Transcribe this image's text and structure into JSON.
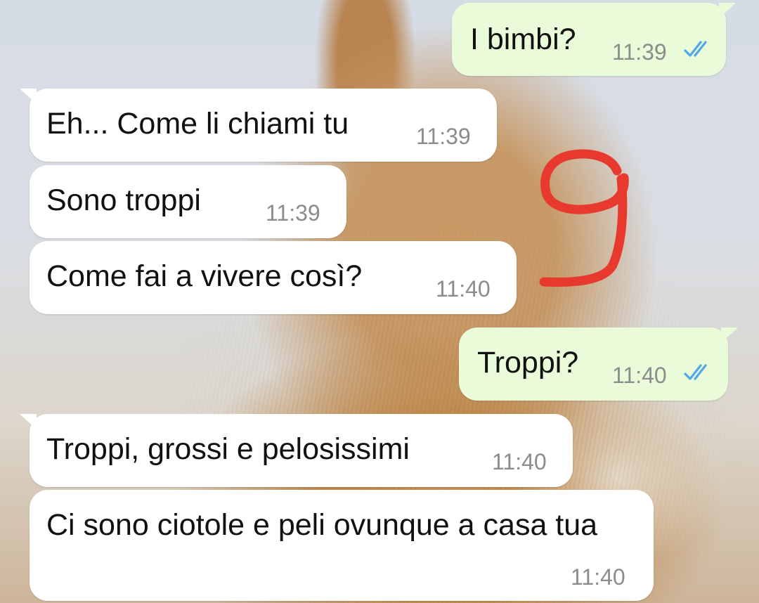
{
  "messages": [
    {
      "direction": "outgoing",
      "text": "I bimbi?",
      "time": "11:39",
      "status": "read-double-check-icon"
    },
    {
      "direction": "incoming",
      "text": "Eh... Come li chiami tu",
      "time": "11:39"
    },
    {
      "direction": "incoming",
      "text": "Sono troppi",
      "time": "11:39"
    },
    {
      "direction": "incoming",
      "text": "Come fai a vivere così?",
      "time": "11:40"
    },
    {
      "direction": "outgoing",
      "text": "Troppi?",
      "time": "11:40",
      "status": "read-double-check-icon"
    },
    {
      "direction": "incoming",
      "text": "Troppi, grossi e pelosissimi",
      "time": "11:40"
    },
    {
      "direction": "incoming",
      "text": "Ci sono ciotole e peli ovunque a casa tua",
      "time": "11:40"
    }
  ],
  "annotation": {
    "text": "9",
    "color": "#e8392f"
  },
  "colors": {
    "incoming_bubble": "#ffffff",
    "outgoing_bubble": "#e9fbd9",
    "timestamp": "#8c8c8c",
    "read_tick": "#4fa8e8"
  }
}
